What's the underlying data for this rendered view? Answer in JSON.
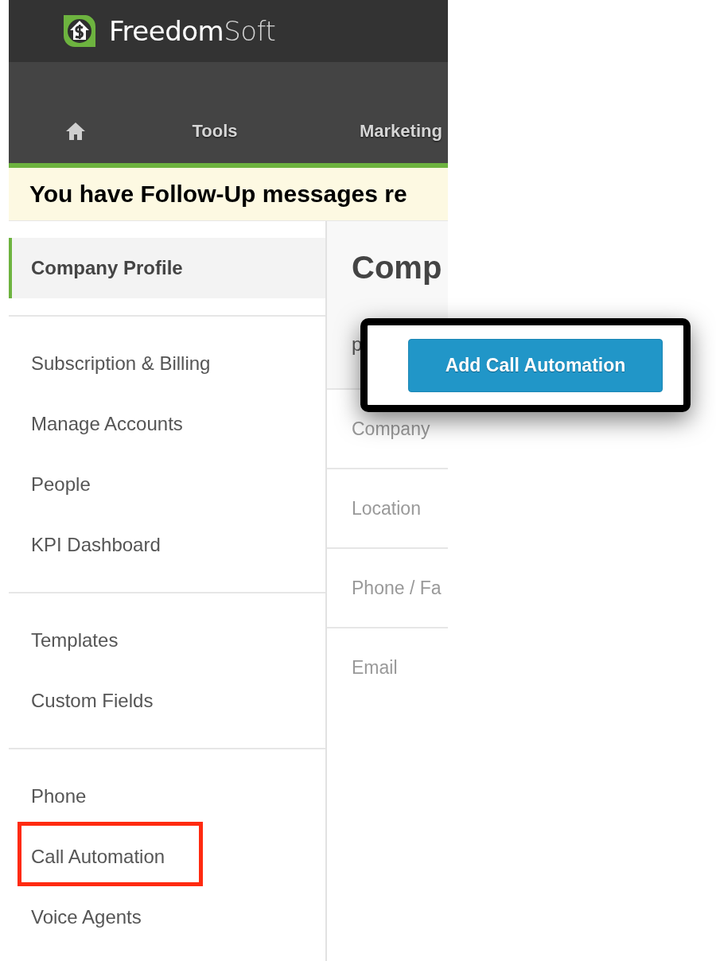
{
  "header": {
    "logo": {
      "primary": "Freedom",
      "secondary": "Soft"
    }
  },
  "nav": [
    {
      "kind": "home"
    },
    {
      "kind": "text",
      "label": "Tools"
    },
    {
      "kind": "text",
      "label": "Marketing"
    }
  ],
  "banner": "You have Follow-Up messages re",
  "sidebar": {
    "groups": [
      {
        "items": [
          {
            "label": "Company Profile",
            "selected": true,
            "highlighted": false
          }
        ]
      },
      {
        "items": [
          {
            "label": "Subscription & Billing",
            "selected": false,
            "highlighted": false
          },
          {
            "label": "Manage Accounts",
            "selected": false,
            "highlighted": false
          },
          {
            "label": "People",
            "selected": false,
            "highlighted": false
          },
          {
            "label": "KPI Dashboard",
            "selected": false,
            "highlighted": false
          }
        ]
      },
      {
        "items": [
          {
            "label": "Templates",
            "selected": false,
            "highlighted": false
          },
          {
            "label": "Custom Fields",
            "selected": false,
            "highlighted": false
          }
        ]
      },
      {
        "items": [
          {
            "label": "Phone",
            "selected": false,
            "highlighted": false
          },
          {
            "label": "Call Automation",
            "selected": false,
            "highlighted": true
          },
          {
            "label": "Voice Agents",
            "selected": false,
            "highlighted": false
          }
        ]
      }
    ]
  },
  "content": {
    "title": "Comp",
    "description_visible": "p",
    "fields": [
      "Company",
      "Location",
      "Phone / Fa",
      "Email"
    ]
  },
  "callout": {
    "button": "Add Call Automation"
  }
}
